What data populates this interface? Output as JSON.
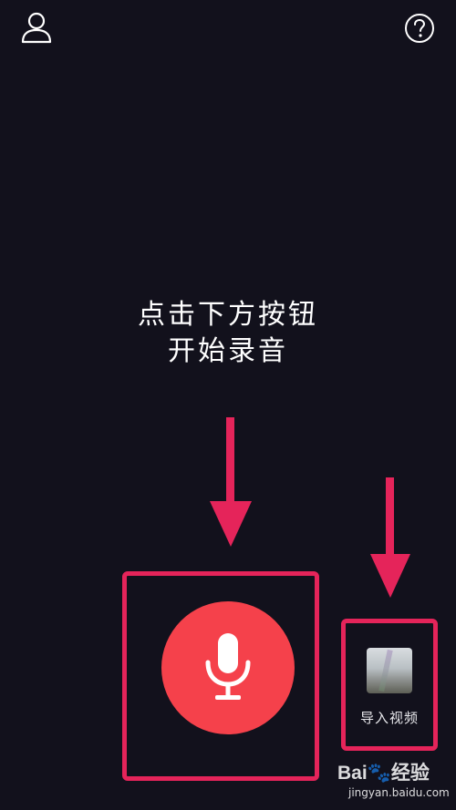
{
  "hint": {
    "line1": "点击下方按钮",
    "line2": "开始录音"
  },
  "import_video": {
    "label": "导入视频"
  },
  "watermark": {
    "logo_text": "Bai🐾经验",
    "url": "jingyan.baidu.com"
  },
  "icons": {
    "profile": "person-outline-icon",
    "help": "question-circle-icon",
    "record": "microphone-icon"
  },
  "colors": {
    "background": "#12111c",
    "record_button": "#f5414b",
    "annotation": "#e5245a"
  }
}
